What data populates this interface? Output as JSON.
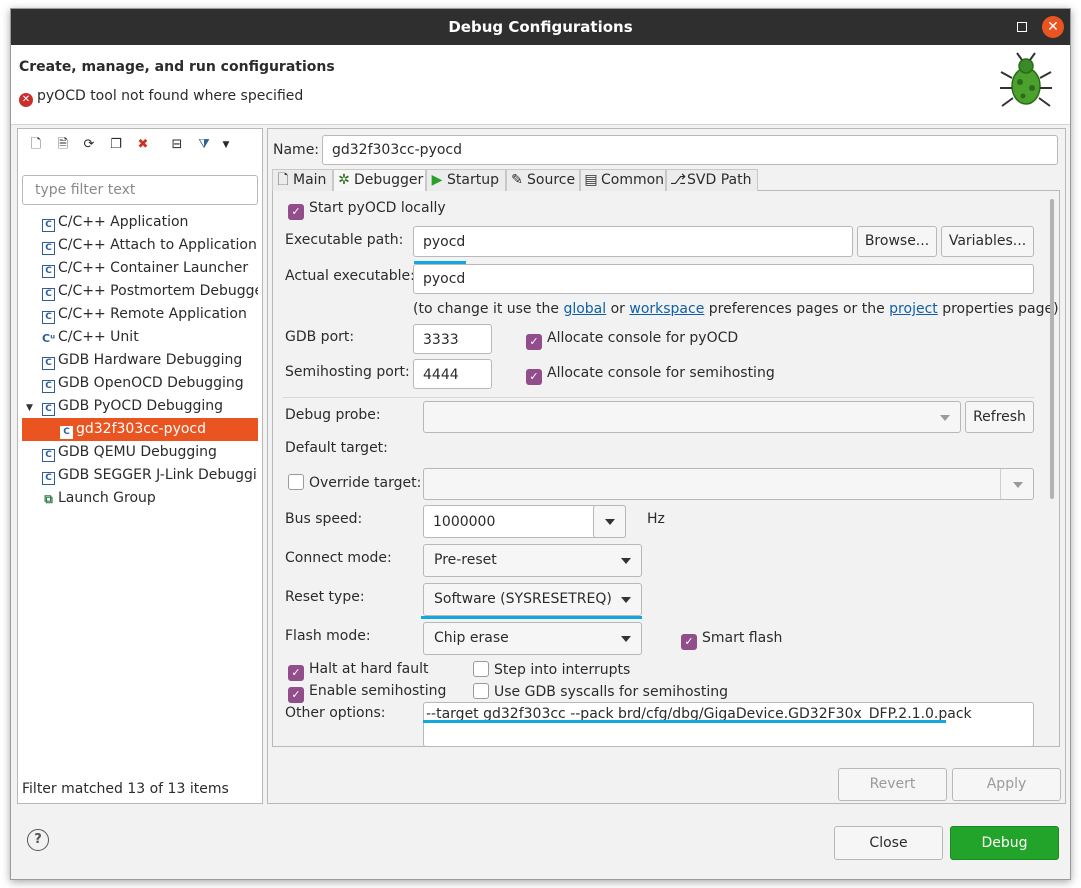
{
  "window": {
    "title": "Debug Configurations"
  },
  "header": {
    "title": "Create, manage, and run configurations",
    "error": "pyOCD tool not found where specified"
  },
  "left": {
    "filter_placeholder": "type filter text",
    "items": [
      {
        "label": "C/C++ Application",
        "icon": "c-app-icon"
      },
      {
        "label": "C/C++ Attach to Application",
        "icon": "c-attach-icon"
      },
      {
        "label": "C/C++ Container Launcher",
        "icon": "c-container-icon"
      },
      {
        "label": "C/C++ Postmortem Debugger",
        "icon": "c-postmortem-icon"
      },
      {
        "label": "C/C++ Remote Application",
        "icon": "c-remote-icon"
      },
      {
        "label": "C/C++ Unit",
        "icon": "c-unit-icon"
      },
      {
        "label": "GDB Hardware Debugging",
        "icon": "gdb-hardware-icon"
      },
      {
        "label": "GDB OpenOCD Debugging",
        "icon": "gdb-openocd-icon"
      },
      {
        "label": "GDB PyOCD Debugging",
        "icon": "gdb-pyocd-icon"
      },
      {
        "label": "gd32f303cc-pyocd",
        "icon": "config-icon"
      },
      {
        "label": "GDB QEMU Debugging",
        "icon": "gdb-qemu-icon"
      },
      {
        "label": "GDB SEGGER J-Link Debugging",
        "icon": "gdb-jlink-icon"
      },
      {
        "label": "Launch Group",
        "icon": "launch-group-icon"
      }
    ],
    "footer": "Filter matched 13 of 13 items"
  },
  "right": {
    "name_label": "Name:",
    "name_value": "gd32f303cc-pyocd",
    "tabs": [
      "Main",
      "Debugger",
      "Startup",
      "Source",
      "Common",
      "SVD Path"
    ],
    "start_locally": "Start pyOCD locally",
    "exec_label": "Executable path:",
    "exec_value": "pyocd",
    "browse": "Browse...",
    "variables": "Variables...",
    "actual_label": "Actual executable:",
    "actual_value": "pyocd",
    "hint_1": "(to change it use the ",
    "hint_global": "global",
    "hint_2": " or ",
    "hint_workspace": "workspace",
    "hint_3": " preferences pages or the ",
    "hint_project": "project",
    "hint_4": " properties page)",
    "gdb_port_label": "GDB port:",
    "gdb_port": "3333",
    "alloc_pyocd": "Allocate console for pyOCD",
    "semi_port_label": "Semihosting port:",
    "semi_port": "4444",
    "alloc_semi": "Allocate console for semihosting",
    "probe_label": "Debug probe:",
    "refresh": "Refresh",
    "default_target_label": "Default target:",
    "override_target": "Override target:",
    "bus_speed_label": "Bus speed:",
    "bus_speed": "1000000",
    "hz": "Hz",
    "connect_label": "Connect mode:",
    "connect_value": "Pre-reset",
    "reset_label": "Reset type:",
    "reset_value": "Software (SYSRESETREQ)",
    "flash_label": "Flash mode:",
    "flash_value": "Chip erase",
    "smart_flash": "Smart flash",
    "halt_fault": "Halt at hard fault",
    "step_interrupts": "Step into interrupts",
    "enable_semi": "Enable semihosting",
    "gdb_syscalls": "Use GDB syscalls for semihosting",
    "other_label": "Other options:",
    "other_value": "--target gd32f303cc --pack brd/cfg/dbg/GigaDevice.GD32F30x_DFP.2.1.0.pack",
    "revert": "Revert",
    "apply": "Apply"
  },
  "bottom": {
    "close": "Close",
    "debug": "Debug"
  },
  "colors": {
    "accent": "#e95420",
    "checkbox": "#924d8b",
    "highlight": "#12a8dc",
    "debug_button": "#22a32a"
  }
}
